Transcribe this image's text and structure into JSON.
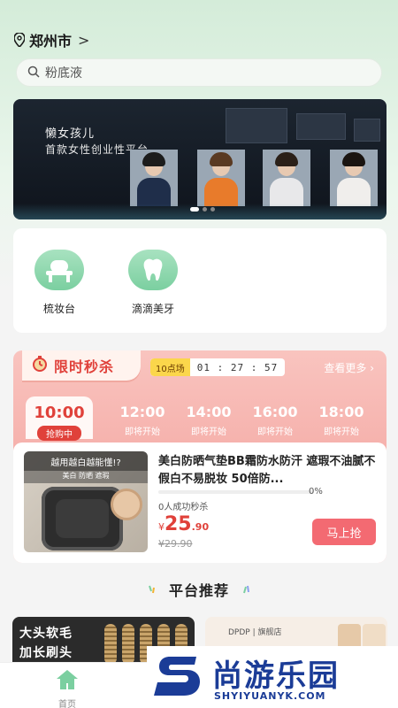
{
  "location": {
    "city": "郑州市",
    "chevron": ">"
  },
  "search": {
    "query": "粉底液"
  },
  "banner": {
    "title_line1": "懒女孩儿",
    "title_line2": "首款女性创业性平台",
    "slide_count": 3,
    "active_slide": 0
  },
  "categories": [
    {
      "label": "梳妆台",
      "icon": "vanity-table-icon"
    },
    {
      "label": "滴滴美牙",
      "icon": "tooth-icon"
    }
  ],
  "flash_sale": {
    "title": "限时秒杀",
    "slot_label": "10点场",
    "countdown": "01 : 27 : 57",
    "more": "查看更多",
    "tabs": [
      {
        "time": "10:00",
        "status": "抢购中",
        "active": true
      },
      {
        "time": "12:00",
        "status": "即将开始",
        "active": false
      },
      {
        "time": "14:00",
        "status": "即将开始",
        "active": false
      },
      {
        "time": "16:00",
        "status": "即将开始",
        "active": false
      },
      {
        "time": "18:00",
        "status": "即将开始",
        "active": false
      }
    ],
    "product": {
      "image_caption": "越用越白越能懂!?",
      "image_subcaption": "美白 防晒 遮瑕",
      "title": "美白防晒气垫BB霜防水防汗 遮瑕不油腻不假白不易脱妆 50倍防...",
      "progress_pct": "0%",
      "progress_value": 0,
      "sold_text": "0人成功秒杀",
      "price_currency": "¥",
      "price_int": "25",
      "price_dec": ".90",
      "original_price": "¥29.90",
      "buy_label": "马上抢"
    }
  },
  "recommend": {
    "title": "平台推荐",
    "left_card_text": [
      "大头软毛",
      "加长刷头"
    ],
    "right_card_text": "DPDP | 旗舰店"
  },
  "nav": {
    "home": "首页"
  },
  "watermark": {
    "text": "尚游乐园",
    "url": "SHYIYUANYK.COM"
  },
  "colors": {
    "accent": "#e0413a",
    "mint": "#7bcfa0",
    "buy": "#f36a72",
    "flash_bg": "#f6b2ad",
    "watermark": "#1b3c97"
  }
}
